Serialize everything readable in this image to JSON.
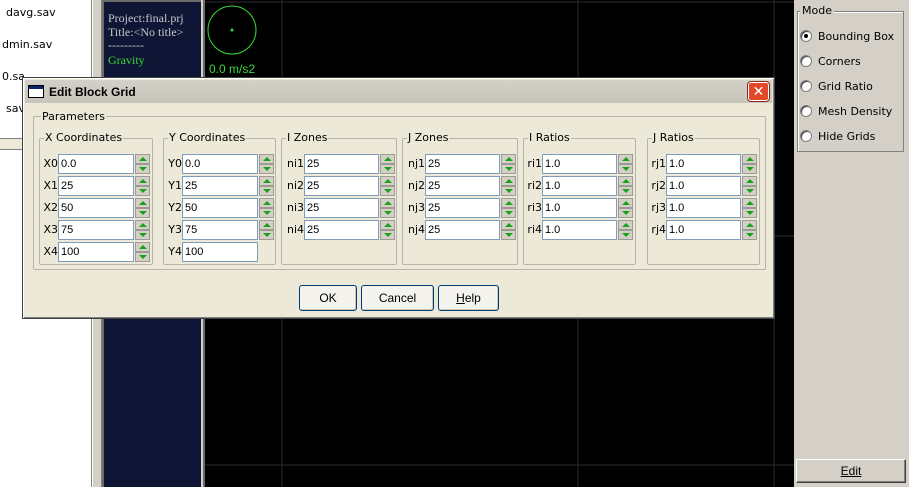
{
  "files": [
    "davg.sav",
    "dmin.sav",
    "0.sa",
    "sav"
  ],
  "info": {
    "project": "Project:final.prj",
    "title": "Title:<No title>",
    "separator": "---------",
    "gravity": "Gravity",
    "acceleration": "0.0 m/s2"
  },
  "mode": {
    "legend": "Mode",
    "options": [
      {
        "label": "Bounding Box",
        "checked": true
      },
      {
        "label": "Corners",
        "checked": false
      },
      {
        "label": "Grid Ratio",
        "checked": false
      },
      {
        "label": "Mesh Density",
        "checked": false
      },
      {
        "label": "Hide Grids",
        "checked": false
      }
    ],
    "edit_label": "Edit"
  },
  "dialog": {
    "title": "Edit Block Grid",
    "close_glyph": "✕",
    "parameters_legend": "Parameters",
    "groups": [
      {
        "legend": "X Coordinates",
        "labels": [
          "X0",
          "X1",
          "X2",
          "X3",
          "X4"
        ],
        "values": [
          "0.0",
          "25",
          "50",
          "75",
          "100"
        ]
      },
      {
        "legend": "Y Coordinates",
        "labels": [
          "Y0",
          "Y1",
          "Y2",
          "Y3",
          "Y4"
        ],
        "values": [
          "0.0",
          "25",
          "50",
          "75",
          "100"
        ]
      },
      {
        "legend": "I Zones",
        "labels": [
          "ni1",
          "ni2",
          "ni3",
          "ni4"
        ],
        "values": [
          "25",
          "25",
          "25",
          "25"
        ]
      },
      {
        "legend": "J Zones",
        "labels": [
          "nj1",
          "nj2",
          "nj3",
          "nj4"
        ],
        "values": [
          "25",
          "25",
          "25",
          "25"
        ]
      },
      {
        "legend": "I Ratios",
        "labels": [
          "ri1",
          "ri2",
          "ri3",
          "ri4"
        ],
        "values": [
          "1.0",
          "1.0",
          "1.0",
          "1.0"
        ]
      },
      {
        "legend": "J Ratios",
        "labels": [
          "rj1",
          "rj2",
          "rj3",
          "rj4"
        ],
        "values": [
          "1.0",
          "1.0",
          "1.0",
          "1.0"
        ]
      }
    ],
    "buttons": {
      "ok": "OK",
      "cancel": "Cancel",
      "help_underlined": "H",
      "help_rest": "elp"
    }
  },
  "colors": {
    "canvas_bg": "#000000",
    "info_bg": "#0e1535",
    "accent_green": "#39d839",
    "grid_line": "#2c2c2c"
  }
}
